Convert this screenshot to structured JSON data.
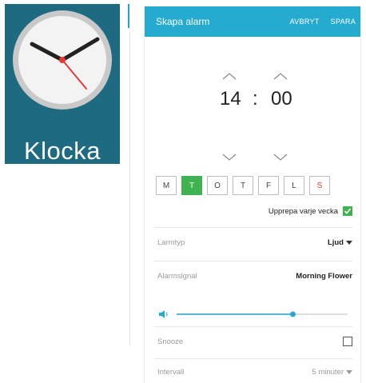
{
  "launcher": {
    "app_name": "Klocka"
  },
  "appbar": {
    "title": "Skapa alarm",
    "cancel": "AVBRYT",
    "save": "SPARA"
  },
  "time": {
    "hour": "14",
    "separator": ":",
    "minute": "00"
  },
  "days": [
    {
      "label": "M",
      "selected": false
    },
    {
      "label": "T",
      "selected": true
    },
    {
      "label": "O",
      "selected": false
    },
    {
      "label": "T",
      "selected": false
    },
    {
      "label": "F",
      "selected": false
    },
    {
      "label": "L",
      "selected": false
    },
    {
      "label": "S",
      "selected": false
    }
  ],
  "repeat": {
    "label": "Upprepa varje vecka",
    "checked": true
  },
  "settings": {
    "alarm_type_label": "Larmtyp",
    "alarm_type_value": "Ljud",
    "alarm_tone_label": "Alarmsignal",
    "alarm_tone_value": "Morning Flower",
    "volume_fraction": 0.68,
    "snooze_label": "Snooze",
    "snooze_checked": false,
    "interval_label": "Intervall",
    "interval_value": "5 minuter"
  },
  "colors": {
    "accent": "#25abd0",
    "selected_day": "#3fb34f",
    "sunday": "#e53935",
    "tile_bg": "#1e6a80"
  }
}
